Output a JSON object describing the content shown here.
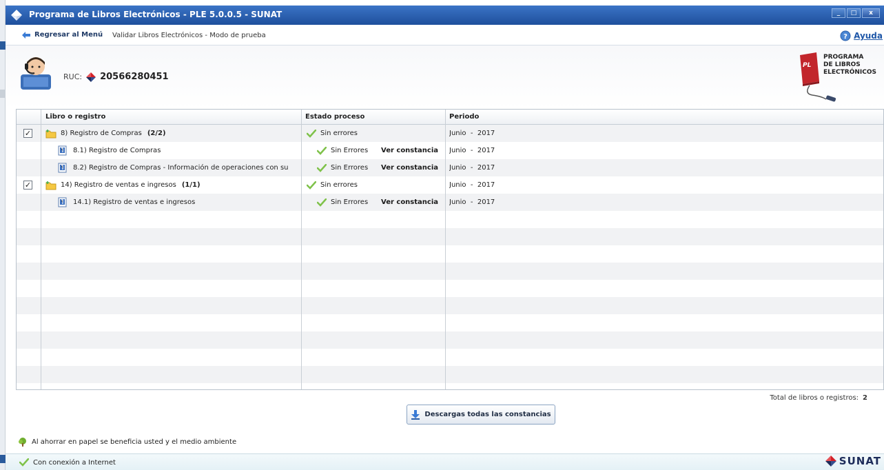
{
  "window": {
    "title": "Programa de Libros Electrónicos - PLE 5.0.0.5 - SUNAT",
    "minimize": "_",
    "maximize": "□",
    "close": "x"
  },
  "nav": {
    "back_label": "Regresar al Menú",
    "breadcrumb": "Validar Libros Electrónicos  - Modo de prueba",
    "help_label": "Ayuda"
  },
  "header": {
    "ruc_label": "RUC:",
    "ruc_value": "20566280451",
    "ple_logo_text": "PROGRAMA\nDE LIBROS\nELECTRÓNICOS",
    "ple_badge": "PL"
  },
  "grid": {
    "columns": [
      "Libro o registro",
      "Estado proceso",
      "Periodo"
    ],
    "rows": [
      {
        "checked": true,
        "type": "folder",
        "indent": 0,
        "label": "8) Registro de Compras",
        "count": "(2/2)",
        "status": "Sin errores",
        "link": "",
        "period": "Junio  -  2017"
      },
      {
        "checked": false,
        "type": "file",
        "indent": 1,
        "label": "8.1) Registro de Compras",
        "count": "",
        "status": "Sin Errores",
        "link": "Ver constancia",
        "period": "Junio  -  2017"
      },
      {
        "checked": false,
        "type": "file",
        "indent": 1,
        "label": "8.2) Registro de Compras - Información de operaciones con su",
        "count": "",
        "status": "Sin Errores",
        "link": "Ver constancia",
        "period": "Junio  -  2017"
      },
      {
        "checked": true,
        "type": "folder",
        "indent": 0,
        "label": "14) Registro de ventas e ingresos",
        "count": "(1/1)",
        "status": "Sin errores",
        "link": "",
        "period": "Junio  -  2017"
      },
      {
        "checked": false,
        "type": "file",
        "indent": 1,
        "label": "14.1) Registro de ventas e ingresos",
        "count": "",
        "status": "Sin Errores",
        "link": "Ver constancia",
        "period": "Junio  -  2017"
      }
    ],
    "empty_rows": 11
  },
  "footer": {
    "total_label": "Total de libros o registros:",
    "total_value": "2",
    "download_label": "Descargas todas las constancias",
    "eco_message": "Al ahorrar en papel se beneficia usted y el medio ambiente",
    "connection_status": "Con conexión a Internet",
    "brand": "SUNAT"
  },
  "colors": {
    "titlebar": "#2a5ea8",
    "ok_green": "#5fb33a",
    "link_blue": "#1f57a8",
    "brand_red": "#d32027",
    "brand_navy": "#1d2c5a"
  },
  "icons": [
    "back-arrow-icon",
    "help-icon",
    "user-avatar-icon",
    "ruc-diamond-icon",
    "ple-logo-icon",
    "folder-icon",
    "file-icon",
    "checkmark-icon",
    "download-icon",
    "tree-icon",
    "sunat-logo-icon"
  ]
}
